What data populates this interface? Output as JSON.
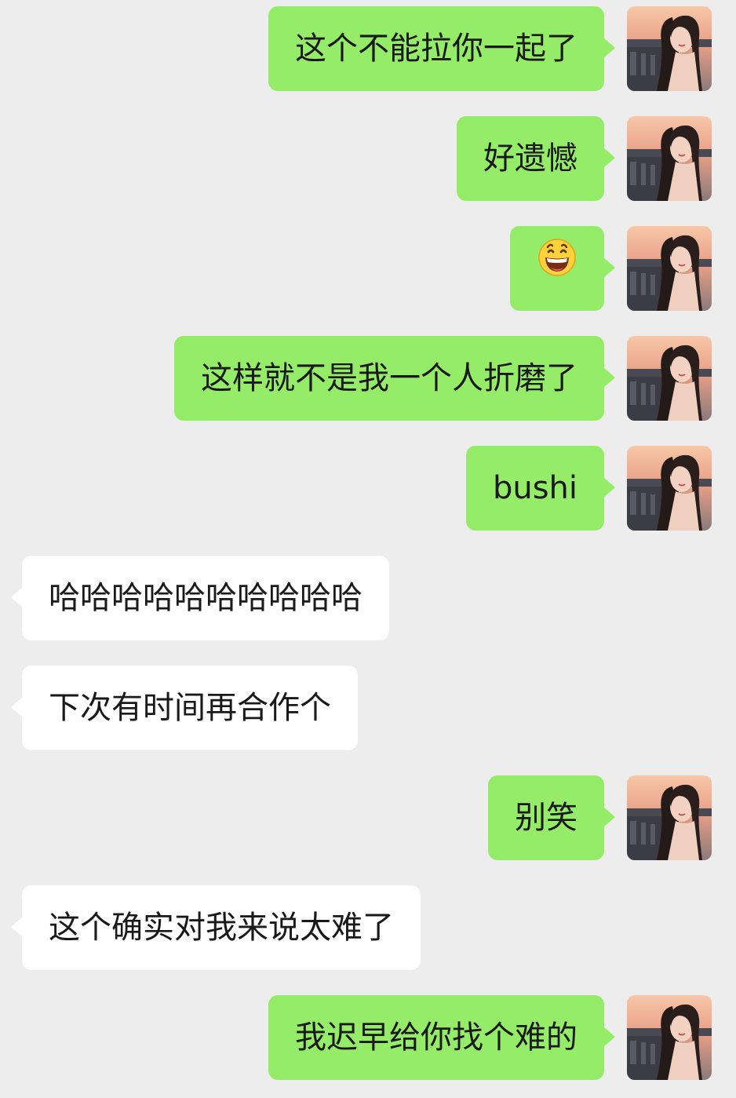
{
  "messages": [
    {
      "side": "me",
      "text": "这个不能拉你一起了",
      "has_avatar": true
    },
    {
      "side": "me",
      "text": "好遗憾",
      "has_avatar": true
    },
    {
      "side": "me",
      "text": "",
      "emoji": "grinning-face-emoji",
      "has_avatar": true
    },
    {
      "side": "me",
      "text": "这样就不是我一个人折磨了",
      "has_avatar": true
    },
    {
      "side": "me",
      "text": "bushi",
      "has_avatar": true
    },
    {
      "side": "them",
      "text": "哈哈哈哈哈哈哈哈哈哈"
    },
    {
      "side": "them",
      "text": "下次有时间再合作个"
    },
    {
      "side": "me",
      "text": "别笑",
      "has_avatar": true
    },
    {
      "side": "them",
      "text": "这个确实对我来说太难了"
    },
    {
      "side": "me",
      "text": "我迟早给你找个难的",
      "has_avatar": true
    }
  ],
  "colors": {
    "background": "#ededed",
    "sent_bubble": "#95ec69",
    "received_bubble": "#ffffff",
    "text": "#191919"
  }
}
